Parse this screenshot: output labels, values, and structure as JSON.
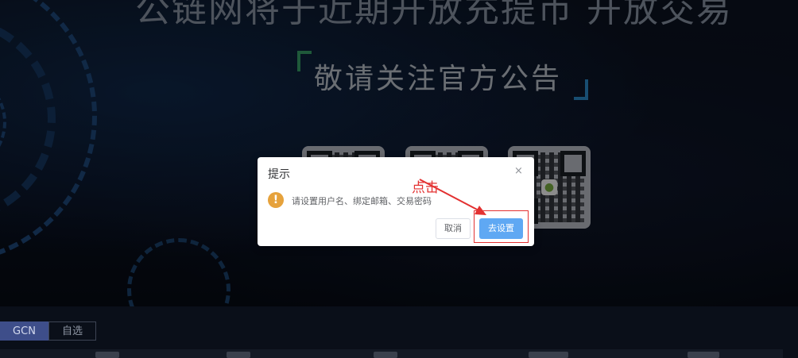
{
  "banner": {
    "headline": "公链网将于近期开放充提币 开放交易",
    "subheadline": "敬请关注官方公告"
  },
  "market_tabs": [
    {
      "label": "GCN"
    },
    {
      "label": "自选"
    }
  ],
  "dialog": {
    "title": "提示",
    "close_glyph": "×",
    "warning_glyph": "!",
    "message": "请设置用户名、绑定邮箱、交易密码",
    "cancel_label": "取消",
    "confirm_label": "去设置"
  },
  "annotation": {
    "text": "点击",
    "color": "#e33131"
  },
  "colors": {
    "accent": "#5fa8f3",
    "warning": "#e6a23c",
    "tab_active": "#3e4e8a"
  }
}
